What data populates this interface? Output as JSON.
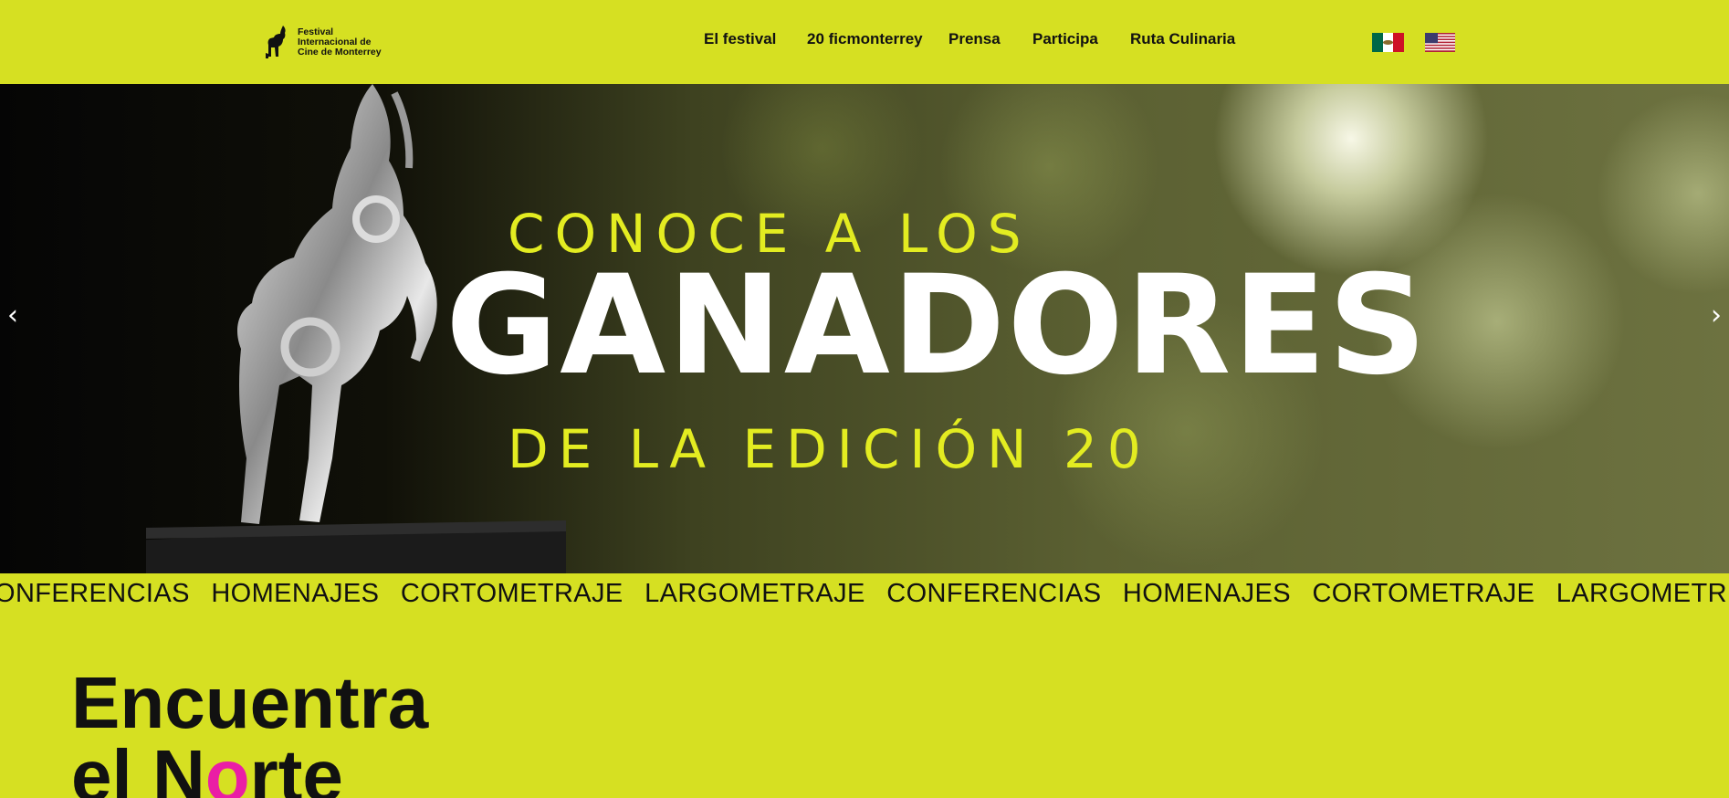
{
  "header": {
    "logo": {
      "line1": "Festival",
      "line2": "Internacional de",
      "line3": "Cine de Monterrey",
      "icon": "goat-icon"
    },
    "nav": [
      {
        "label": "El festival"
      },
      {
        "label": "20 ficmonterrey"
      },
      {
        "label": "Prensa"
      },
      {
        "label": "Participa"
      },
      {
        "label": "Ruta Culinaria"
      }
    ],
    "languages": [
      {
        "icon": "flag-mexico-icon"
      },
      {
        "icon": "flag-usa-icon"
      }
    ]
  },
  "hero": {
    "kicker": "CONOCE A LOS",
    "title": "GANADORES",
    "subtitle": "DE LA EDICIÓN 20",
    "prev_icon": "chevron-left-icon",
    "next_icon": "chevron-right-icon",
    "prev_glyph": "‹",
    "next_glyph": "›"
  },
  "ticker": {
    "items": [
      "ONFERENCIAS",
      "HOMENAJES",
      "CORTOMETRAJE",
      "LARGOMETRAJE",
      "CONFERENCIAS",
      "HOMENAJES",
      "CORTOMETRAJE",
      "LARGOMETR"
    ]
  },
  "intro": {
    "line1": "Encuentra",
    "line2_pre": "el N",
    "line2_accent": "o",
    "line2_post": "rte"
  },
  "colors": {
    "background": "#d6e022",
    "hero_kicker": "#e3ec21",
    "accent": "#ea1ea5",
    "text": "#111111"
  }
}
